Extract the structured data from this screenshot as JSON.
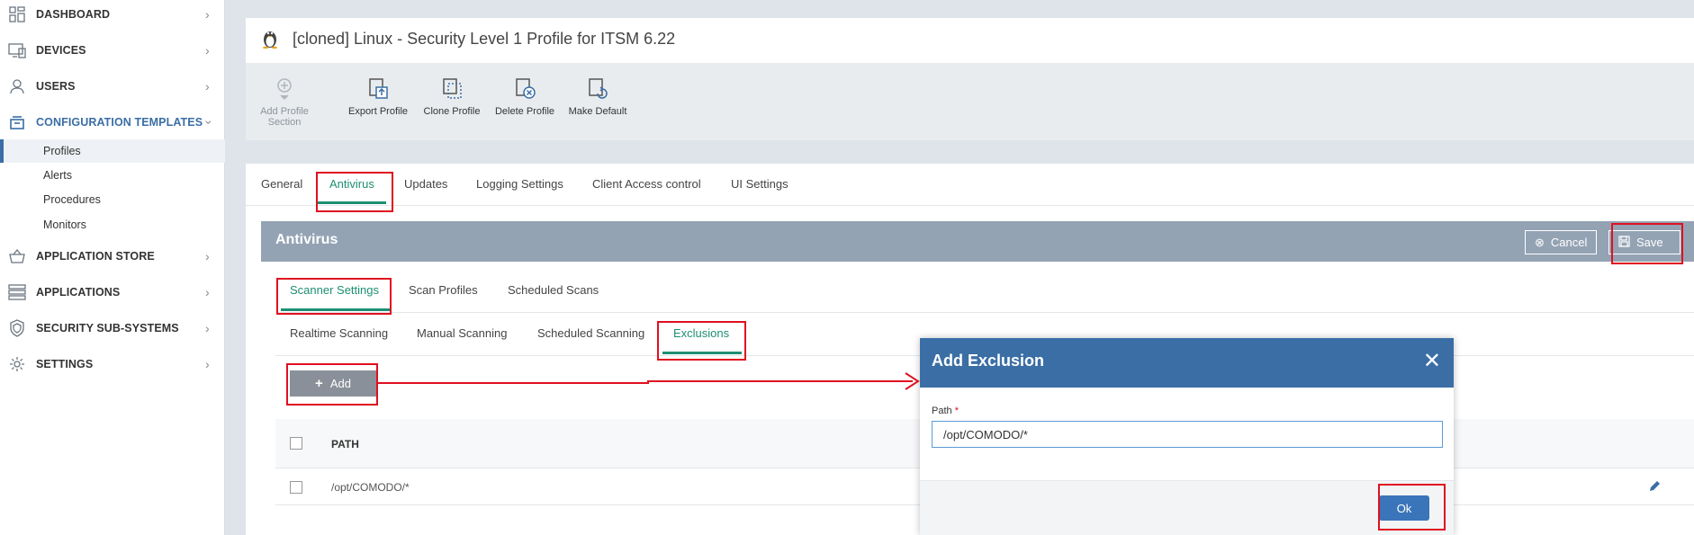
{
  "sidebar": {
    "items": [
      {
        "label": "DASHBOARD",
        "icon": "dashboard-icon"
      },
      {
        "label": "DEVICES",
        "icon": "devices-icon"
      },
      {
        "label": "USERS",
        "icon": "user-icon"
      },
      {
        "label": "CONFIGURATION TEMPLATES",
        "icon": "templates-icon"
      },
      {
        "label": "APPLICATION STORE",
        "icon": "basket-icon"
      },
      {
        "label": "APPLICATIONS",
        "icon": "applications-icon"
      },
      {
        "label": "SECURITY SUB-SYSTEMS",
        "icon": "shield-icon"
      },
      {
        "label": "SETTINGS",
        "icon": "gear-icon"
      }
    ],
    "subitems": [
      "Profiles",
      "Alerts",
      "Procedures",
      "Monitors"
    ]
  },
  "page": {
    "title": "[cloned] Linux - Security Level 1 Profile for ITSM 6.22"
  },
  "toolbar": {
    "add_section_line1": "Add Profile",
    "add_section_line2": "Section",
    "export": "Export Profile",
    "clone": "Clone Profile",
    "delete": "Delete Profile",
    "make_default": "Make Default"
  },
  "tabs": [
    "General",
    "Antivirus",
    "Updates",
    "Logging Settings",
    "Client Access control",
    "UI Settings"
  ],
  "antivirus": {
    "title": "Antivirus",
    "cancel": "Cancel",
    "save": "Save",
    "subtabs": [
      "Scanner Settings",
      "Scan Profiles",
      "Scheduled Scans"
    ],
    "scantabs": [
      "Realtime Scanning",
      "Manual Scanning",
      "Scheduled Scanning",
      "Exclusions"
    ],
    "add": "Add",
    "table": {
      "header": "PATH",
      "rows": [
        "/opt/COMODO/*"
      ]
    }
  },
  "modal": {
    "title": "Add Exclusion",
    "path_label": "Path",
    "required": "*",
    "path_value": "/opt/COMODO/*",
    "ok": "Ok"
  },
  "colors": {
    "accent": "#1e8f72",
    "header_blue": "#3a6ea5",
    "annotation_red": "#e01020"
  }
}
